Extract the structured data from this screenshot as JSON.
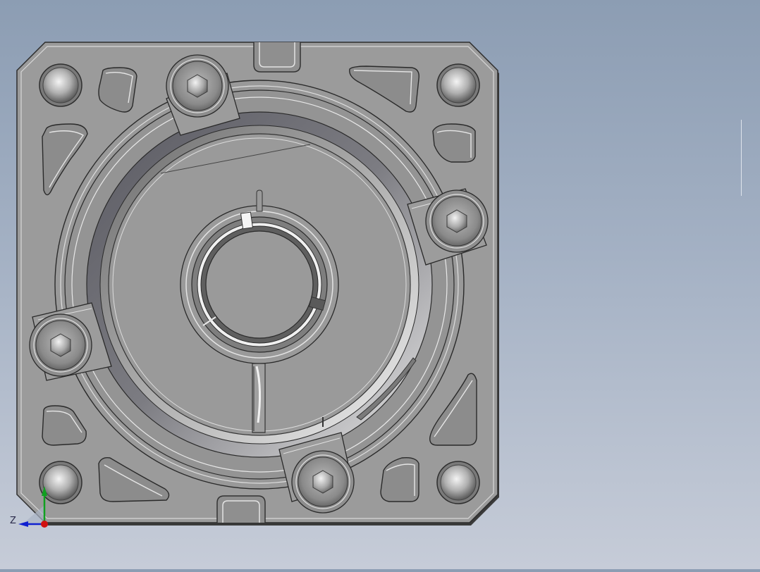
{
  "viewport": {
    "background_top": "#8c9db3",
    "background_bottom": "#c6ccd8"
  },
  "part": {
    "plate_color": "#9a9a9a",
    "edge_color": "#3a3a3a",
    "bolt_color": "#8a8a8a",
    "mounting_holes": 4,
    "socket_head_bolts": 4,
    "lightening_pockets": 8
  },
  "triad": {
    "z_label": "Z",
    "x_color": "#d01010",
    "y_color": "#10a020",
    "z_color": "#1020d0"
  }
}
